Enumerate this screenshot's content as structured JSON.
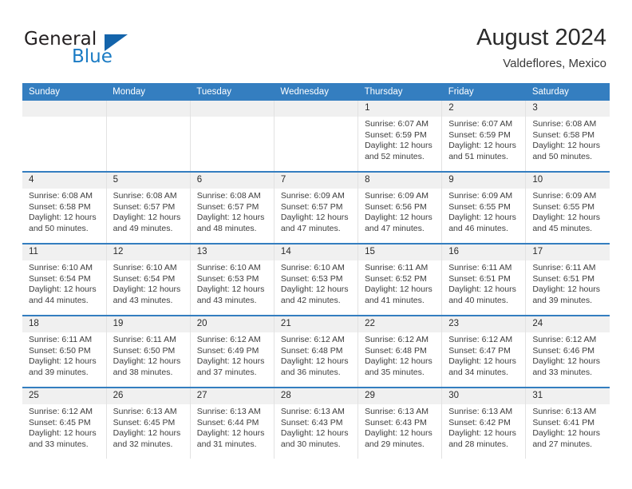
{
  "brand": {
    "name_top": "General",
    "name_bottom": "Blue",
    "accent_color": "#1464ab",
    "text_color": "#231f20"
  },
  "header": {
    "title": "August 2024",
    "subtitle": "Valdeflores, Mexico"
  },
  "calendar": {
    "header_bg": "#347ec0",
    "daynum_bg": "#f0f0f0",
    "weekdays": [
      "Sunday",
      "Monday",
      "Tuesday",
      "Wednesday",
      "Thursday",
      "Friday",
      "Saturday"
    ],
    "weeks": [
      [
        {
          "day": "",
          "empty": true
        },
        {
          "day": "",
          "empty": true
        },
        {
          "day": "",
          "empty": true
        },
        {
          "day": "",
          "empty": true
        },
        {
          "day": "1",
          "sunrise": "Sunrise: 6:07 AM",
          "sunset": "Sunset: 6:59 PM",
          "daylight_1": "Daylight: 12 hours",
          "daylight_2": "and 52 minutes."
        },
        {
          "day": "2",
          "sunrise": "Sunrise: 6:07 AM",
          "sunset": "Sunset: 6:59 PM",
          "daylight_1": "Daylight: 12 hours",
          "daylight_2": "and 51 minutes."
        },
        {
          "day": "3",
          "sunrise": "Sunrise: 6:08 AM",
          "sunset": "Sunset: 6:58 PM",
          "daylight_1": "Daylight: 12 hours",
          "daylight_2": "and 50 minutes."
        }
      ],
      [
        {
          "day": "4",
          "sunrise": "Sunrise: 6:08 AM",
          "sunset": "Sunset: 6:58 PM",
          "daylight_1": "Daylight: 12 hours",
          "daylight_2": "and 50 minutes."
        },
        {
          "day": "5",
          "sunrise": "Sunrise: 6:08 AM",
          "sunset": "Sunset: 6:57 PM",
          "daylight_1": "Daylight: 12 hours",
          "daylight_2": "and 49 minutes."
        },
        {
          "day": "6",
          "sunrise": "Sunrise: 6:08 AM",
          "sunset": "Sunset: 6:57 PM",
          "daylight_1": "Daylight: 12 hours",
          "daylight_2": "and 48 minutes."
        },
        {
          "day": "7",
          "sunrise": "Sunrise: 6:09 AM",
          "sunset": "Sunset: 6:57 PM",
          "daylight_1": "Daylight: 12 hours",
          "daylight_2": "and 47 minutes."
        },
        {
          "day": "8",
          "sunrise": "Sunrise: 6:09 AM",
          "sunset": "Sunset: 6:56 PM",
          "daylight_1": "Daylight: 12 hours",
          "daylight_2": "and 47 minutes."
        },
        {
          "day": "9",
          "sunrise": "Sunrise: 6:09 AM",
          "sunset": "Sunset: 6:55 PM",
          "daylight_1": "Daylight: 12 hours",
          "daylight_2": "and 46 minutes."
        },
        {
          "day": "10",
          "sunrise": "Sunrise: 6:09 AM",
          "sunset": "Sunset: 6:55 PM",
          "daylight_1": "Daylight: 12 hours",
          "daylight_2": "and 45 minutes."
        }
      ],
      [
        {
          "day": "11",
          "sunrise": "Sunrise: 6:10 AM",
          "sunset": "Sunset: 6:54 PM",
          "daylight_1": "Daylight: 12 hours",
          "daylight_2": "and 44 minutes."
        },
        {
          "day": "12",
          "sunrise": "Sunrise: 6:10 AM",
          "sunset": "Sunset: 6:54 PM",
          "daylight_1": "Daylight: 12 hours",
          "daylight_2": "and 43 minutes."
        },
        {
          "day": "13",
          "sunrise": "Sunrise: 6:10 AM",
          "sunset": "Sunset: 6:53 PM",
          "daylight_1": "Daylight: 12 hours",
          "daylight_2": "and 43 minutes."
        },
        {
          "day": "14",
          "sunrise": "Sunrise: 6:10 AM",
          "sunset": "Sunset: 6:53 PM",
          "daylight_1": "Daylight: 12 hours",
          "daylight_2": "and 42 minutes."
        },
        {
          "day": "15",
          "sunrise": "Sunrise: 6:11 AM",
          "sunset": "Sunset: 6:52 PM",
          "daylight_1": "Daylight: 12 hours",
          "daylight_2": "and 41 minutes."
        },
        {
          "day": "16",
          "sunrise": "Sunrise: 6:11 AM",
          "sunset": "Sunset: 6:51 PM",
          "daylight_1": "Daylight: 12 hours",
          "daylight_2": "and 40 minutes."
        },
        {
          "day": "17",
          "sunrise": "Sunrise: 6:11 AM",
          "sunset": "Sunset: 6:51 PM",
          "daylight_1": "Daylight: 12 hours",
          "daylight_2": "and 39 minutes."
        }
      ],
      [
        {
          "day": "18",
          "sunrise": "Sunrise: 6:11 AM",
          "sunset": "Sunset: 6:50 PM",
          "daylight_1": "Daylight: 12 hours",
          "daylight_2": "and 39 minutes."
        },
        {
          "day": "19",
          "sunrise": "Sunrise: 6:11 AM",
          "sunset": "Sunset: 6:50 PM",
          "daylight_1": "Daylight: 12 hours",
          "daylight_2": "and 38 minutes."
        },
        {
          "day": "20",
          "sunrise": "Sunrise: 6:12 AM",
          "sunset": "Sunset: 6:49 PM",
          "daylight_1": "Daylight: 12 hours",
          "daylight_2": "and 37 minutes."
        },
        {
          "day": "21",
          "sunrise": "Sunrise: 6:12 AM",
          "sunset": "Sunset: 6:48 PM",
          "daylight_1": "Daylight: 12 hours",
          "daylight_2": "and 36 minutes."
        },
        {
          "day": "22",
          "sunrise": "Sunrise: 6:12 AM",
          "sunset": "Sunset: 6:48 PM",
          "daylight_1": "Daylight: 12 hours",
          "daylight_2": "and 35 minutes."
        },
        {
          "day": "23",
          "sunrise": "Sunrise: 6:12 AM",
          "sunset": "Sunset: 6:47 PM",
          "daylight_1": "Daylight: 12 hours",
          "daylight_2": "and 34 minutes."
        },
        {
          "day": "24",
          "sunrise": "Sunrise: 6:12 AM",
          "sunset": "Sunset: 6:46 PM",
          "daylight_1": "Daylight: 12 hours",
          "daylight_2": "and 33 minutes."
        }
      ],
      [
        {
          "day": "25",
          "sunrise": "Sunrise: 6:12 AM",
          "sunset": "Sunset: 6:45 PM",
          "daylight_1": "Daylight: 12 hours",
          "daylight_2": "and 33 minutes."
        },
        {
          "day": "26",
          "sunrise": "Sunrise: 6:13 AM",
          "sunset": "Sunset: 6:45 PM",
          "daylight_1": "Daylight: 12 hours",
          "daylight_2": "and 32 minutes."
        },
        {
          "day": "27",
          "sunrise": "Sunrise: 6:13 AM",
          "sunset": "Sunset: 6:44 PM",
          "daylight_1": "Daylight: 12 hours",
          "daylight_2": "and 31 minutes."
        },
        {
          "day": "28",
          "sunrise": "Sunrise: 6:13 AM",
          "sunset": "Sunset: 6:43 PM",
          "daylight_1": "Daylight: 12 hours",
          "daylight_2": "and 30 minutes."
        },
        {
          "day": "29",
          "sunrise": "Sunrise: 6:13 AM",
          "sunset": "Sunset: 6:43 PM",
          "daylight_1": "Daylight: 12 hours",
          "daylight_2": "and 29 minutes."
        },
        {
          "day": "30",
          "sunrise": "Sunrise: 6:13 AM",
          "sunset": "Sunset: 6:42 PM",
          "daylight_1": "Daylight: 12 hours",
          "daylight_2": "and 28 minutes."
        },
        {
          "day": "31",
          "sunrise": "Sunrise: 6:13 AM",
          "sunset": "Sunset: 6:41 PM",
          "daylight_1": "Daylight: 12 hours",
          "daylight_2": "and 27 minutes."
        }
      ]
    ]
  }
}
